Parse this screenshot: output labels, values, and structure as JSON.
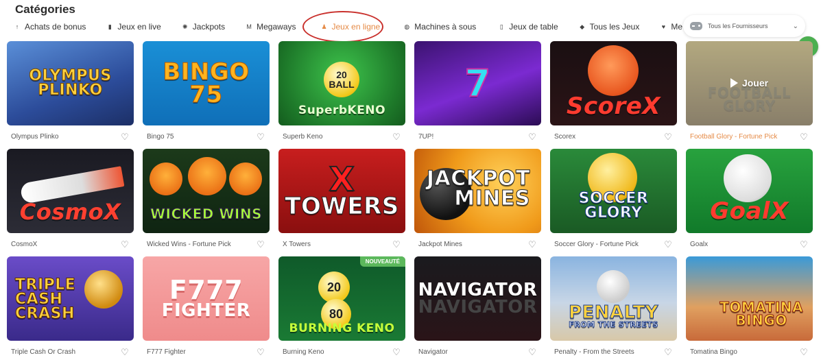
{
  "page": {
    "title": "Catégories"
  },
  "categories": [
    {
      "label": "Achats de bonus",
      "icon": "bonus-buy-icon",
      "glyph": "↑"
    },
    {
      "label": "Jeux en live",
      "icon": "video-camera-icon",
      "glyph": "▮"
    },
    {
      "label": "Jackpots",
      "icon": "jackpot-icon",
      "glyph": "✺"
    },
    {
      "label": "Megaways",
      "icon": "megaways-icon",
      "glyph": "M"
    },
    {
      "label": "Jeux en ligne",
      "icon": "online-games-icon",
      "glyph": "♟",
      "active": true
    },
    {
      "label": "Machines à sous",
      "icon": "slot-machine-icon",
      "glyph": "◍"
    },
    {
      "label": "Jeux de table",
      "icon": "table-games-icon",
      "glyph": "▯"
    },
    {
      "label": "Tous les Jeux",
      "icon": "all-games-icon",
      "glyph": "◆"
    },
    {
      "label": "Me",
      "icon": "heart-icon",
      "glyph": "♥"
    }
  ],
  "provider_filter": {
    "label": "Tous les Fournisseurs",
    "icon": "gamepad-icon"
  },
  "overlay": {
    "play_label": "Jouer"
  },
  "games": [
    {
      "name": "Olympus Plinko",
      "art": "OLYMPUS\nPLINKO"
    },
    {
      "name": "Bingo 75",
      "art": "BINGO 75"
    },
    {
      "name": "Superb Keno",
      "art": "SuperbKENO",
      "ball": "20\nBALL"
    },
    {
      "name": "7UP!",
      "art": "7"
    },
    {
      "name": "Scorex",
      "art": "ScoreX"
    },
    {
      "name": "Football Glory - Fortune Pick",
      "art": "FOOTBALL GLORY"
    },
    {
      "name": "CosmoX",
      "art": "CosmoX"
    },
    {
      "name": "Wicked Wins - Fortune Pick",
      "art": "WICKED WINS"
    },
    {
      "name": "X Towers",
      "art": "TOWERS",
      "x": "X"
    },
    {
      "name": "Jackpot Mines",
      "art": "JACKPOT\nMINES"
    },
    {
      "name": "Soccer Glory - Fortune Pick",
      "art": "SOCCER GLORY"
    },
    {
      "name": "Goalx",
      "art": "GoalX"
    },
    {
      "name": "Triple Cash Or Crash",
      "art": "TRIPLE\nCASH\nCRASH"
    },
    {
      "name": "F777 Fighter",
      "art": "F777",
      "art_sub": "FIGHTER"
    },
    {
      "name": "Burning Keno",
      "art": "BURNING KENO",
      "ball1": "20",
      "ball2": "80",
      "badge": "NOUVEAUTÉ"
    },
    {
      "name": "Navigator",
      "art": "NAVIGATOR",
      "art_ghost": "NAVIGATOR"
    },
    {
      "name": "Penalty - From the Streets",
      "art": "PENALTY",
      "art_sub": "FROM THE STREETS"
    },
    {
      "name": "Tomatina Bingo",
      "art": "TOMATINA\nBINGO"
    }
  ],
  "colors": {
    "accent": "#e58a45",
    "highlight_ring": "#c9302c",
    "chat": "#4caf50",
    "badge": "#5cb85c"
  }
}
